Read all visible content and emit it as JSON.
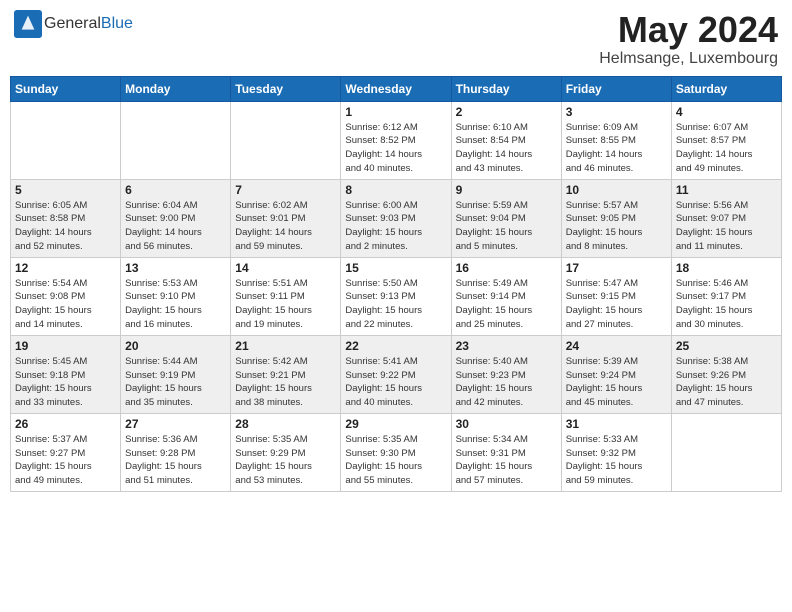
{
  "header": {
    "logo_general": "General",
    "logo_blue": "Blue",
    "month_title": "May 2024",
    "location": "Helmsange, Luxembourg"
  },
  "weekdays": [
    "Sunday",
    "Monday",
    "Tuesday",
    "Wednesday",
    "Thursday",
    "Friday",
    "Saturday"
  ],
  "weeks": [
    [
      {
        "day": "",
        "info": ""
      },
      {
        "day": "",
        "info": ""
      },
      {
        "day": "",
        "info": ""
      },
      {
        "day": "1",
        "info": "Sunrise: 6:12 AM\nSunset: 8:52 PM\nDaylight: 14 hours\nand 40 minutes."
      },
      {
        "day": "2",
        "info": "Sunrise: 6:10 AM\nSunset: 8:54 PM\nDaylight: 14 hours\nand 43 minutes."
      },
      {
        "day": "3",
        "info": "Sunrise: 6:09 AM\nSunset: 8:55 PM\nDaylight: 14 hours\nand 46 minutes."
      },
      {
        "day": "4",
        "info": "Sunrise: 6:07 AM\nSunset: 8:57 PM\nDaylight: 14 hours\nand 49 minutes."
      }
    ],
    [
      {
        "day": "5",
        "info": "Sunrise: 6:05 AM\nSunset: 8:58 PM\nDaylight: 14 hours\nand 52 minutes."
      },
      {
        "day": "6",
        "info": "Sunrise: 6:04 AM\nSunset: 9:00 PM\nDaylight: 14 hours\nand 56 minutes."
      },
      {
        "day": "7",
        "info": "Sunrise: 6:02 AM\nSunset: 9:01 PM\nDaylight: 14 hours\nand 59 minutes."
      },
      {
        "day": "8",
        "info": "Sunrise: 6:00 AM\nSunset: 9:03 PM\nDaylight: 15 hours\nand 2 minutes."
      },
      {
        "day": "9",
        "info": "Sunrise: 5:59 AM\nSunset: 9:04 PM\nDaylight: 15 hours\nand 5 minutes."
      },
      {
        "day": "10",
        "info": "Sunrise: 5:57 AM\nSunset: 9:05 PM\nDaylight: 15 hours\nand 8 minutes."
      },
      {
        "day": "11",
        "info": "Sunrise: 5:56 AM\nSunset: 9:07 PM\nDaylight: 15 hours\nand 11 minutes."
      }
    ],
    [
      {
        "day": "12",
        "info": "Sunrise: 5:54 AM\nSunset: 9:08 PM\nDaylight: 15 hours\nand 14 minutes."
      },
      {
        "day": "13",
        "info": "Sunrise: 5:53 AM\nSunset: 9:10 PM\nDaylight: 15 hours\nand 16 minutes."
      },
      {
        "day": "14",
        "info": "Sunrise: 5:51 AM\nSunset: 9:11 PM\nDaylight: 15 hours\nand 19 minutes."
      },
      {
        "day": "15",
        "info": "Sunrise: 5:50 AM\nSunset: 9:13 PM\nDaylight: 15 hours\nand 22 minutes."
      },
      {
        "day": "16",
        "info": "Sunrise: 5:49 AM\nSunset: 9:14 PM\nDaylight: 15 hours\nand 25 minutes."
      },
      {
        "day": "17",
        "info": "Sunrise: 5:47 AM\nSunset: 9:15 PM\nDaylight: 15 hours\nand 27 minutes."
      },
      {
        "day": "18",
        "info": "Sunrise: 5:46 AM\nSunset: 9:17 PM\nDaylight: 15 hours\nand 30 minutes."
      }
    ],
    [
      {
        "day": "19",
        "info": "Sunrise: 5:45 AM\nSunset: 9:18 PM\nDaylight: 15 hours\nand 33 minutes."
      },
      {
        "day": "20",
        "info": "Sunrise: 5:44 AM\nSunset: 9:19 PM\nDaylight: 15 hours\nand 35 minutes."
      },
      {
        "day": "21",
        "info": "Sunrise: 5:42 AM\nSunset: 9:21 PM\nDaylight: 15 hours\nand 38 minutes."
      },
      {
        "day": "22",
        "info": "Sunrise: 5:41 AM\nSunset: 9:22 PM\nDaylight: 15 hours\nand 40 minutes."
      },
      {
        "day": "23",
        "info": "Sunrise: 5:40 AM\nSunset: 9:23 PM\nDaylight: 15 hours\nand 42 minutes."
      },
      {
        "day": "24",
        "info": "Sunrise: 5:39 AM\nSunset: 9:24 PM\nDaylight: 15 hours\nand 45 minutes."
      },
      {
        "day": "25",
        "info": "Sunrise: 5:38 AM\nSunset: 9:26 PM\nDaylight: 15 hours\nand 47 minutes."
      }
    ],
    [
      {
        "day": "26",
        "info": "Sunrise: 5:37 AM\nSunset: 9:27 PM\nDaylight: 15 hours\nand 49 minutes."
      },
      {
        "day": "27",
        "info": "Sunrise: 5:36 AM\nSunset: 9:28 PM\nDaylight: 15 hours\nand 51 minutes."
      },
      {
        "day": "28",
        "info": "Sunrise: 5:35 AM\nSunset: 9:29 PM\nDaylight: 15 hours\nand 53 minutes."
      },
      {
        "day": "29",
        "info": "Sunrise: 5:35 AM\nSunset: 9:30 PM\nDaylight: 15 hours\nand 55 minutes."
      },
      {
        "day": "30",
        "info": "Sunrise: 5:34 AM\nSunset: 9:31 PM\nDaylight: 15 hours\nand 57 minutes."
      },
      {
        "day": "31",
        "info": "Sunrise: 5:33 AM\nSunset: 9:32 PM\nDaylight: 15 hours\nand 59 minutes."
      },
      {
        "day": "",
        "info": ""
      }
    ]
  ]
}
